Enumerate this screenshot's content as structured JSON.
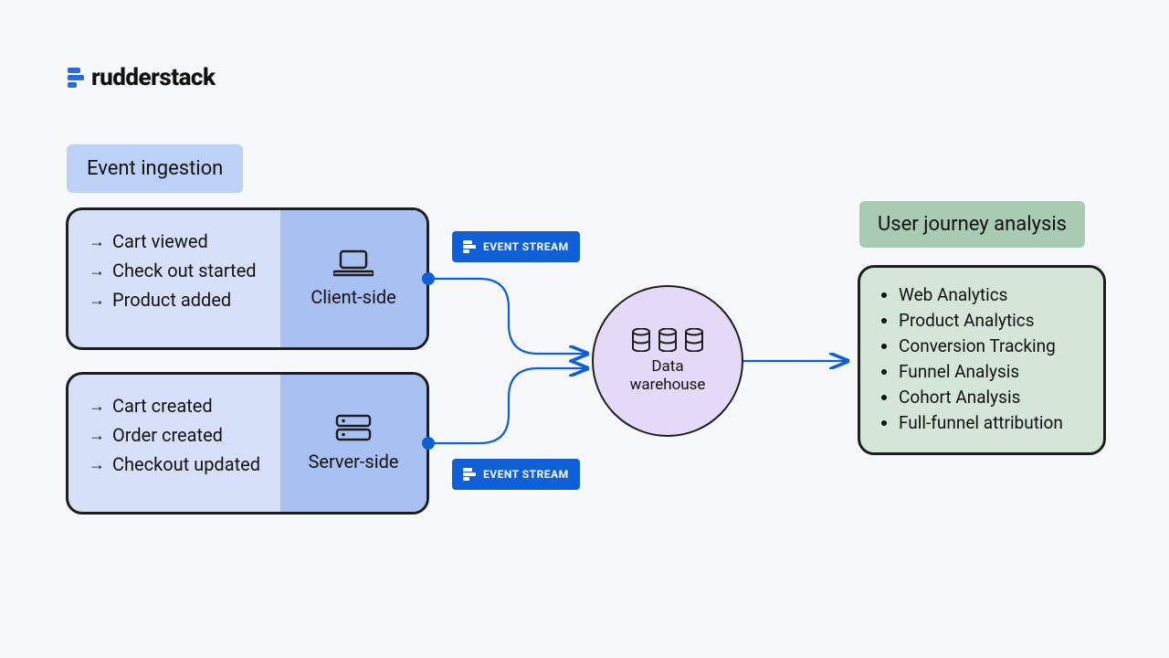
{
  "brand": {
    "name": "rudderstack"
  },
  "ingestion": {
    "header": "Event ingestion",
    "panels": [
      {
        "side_label": "Client-side",
        "events": [
          "Cart viewed",
          "Check out started",
          "Product added"
        ]
      },
      {
        "side_label": "Server-side",
        "events": [
          "Cart created",
          "Order created",
          "Checkout updated"
        ]
      }
    ]
  },
  "stream_badge": {
    "label": "EVENT STREAM"
  },
  "data_warehouse": {
    "label": "Data\nwarehouse"
  },
  "user_journey": {
    "header": "User journey analysis",
    "items": [
      "Web Analytics",
      "Product Analytics",
      "Conversion Tracking",
      "Funnel Analysis",
      "Cohort Analysis",
      "Full-funnel attribution"
    ]
  }
}
